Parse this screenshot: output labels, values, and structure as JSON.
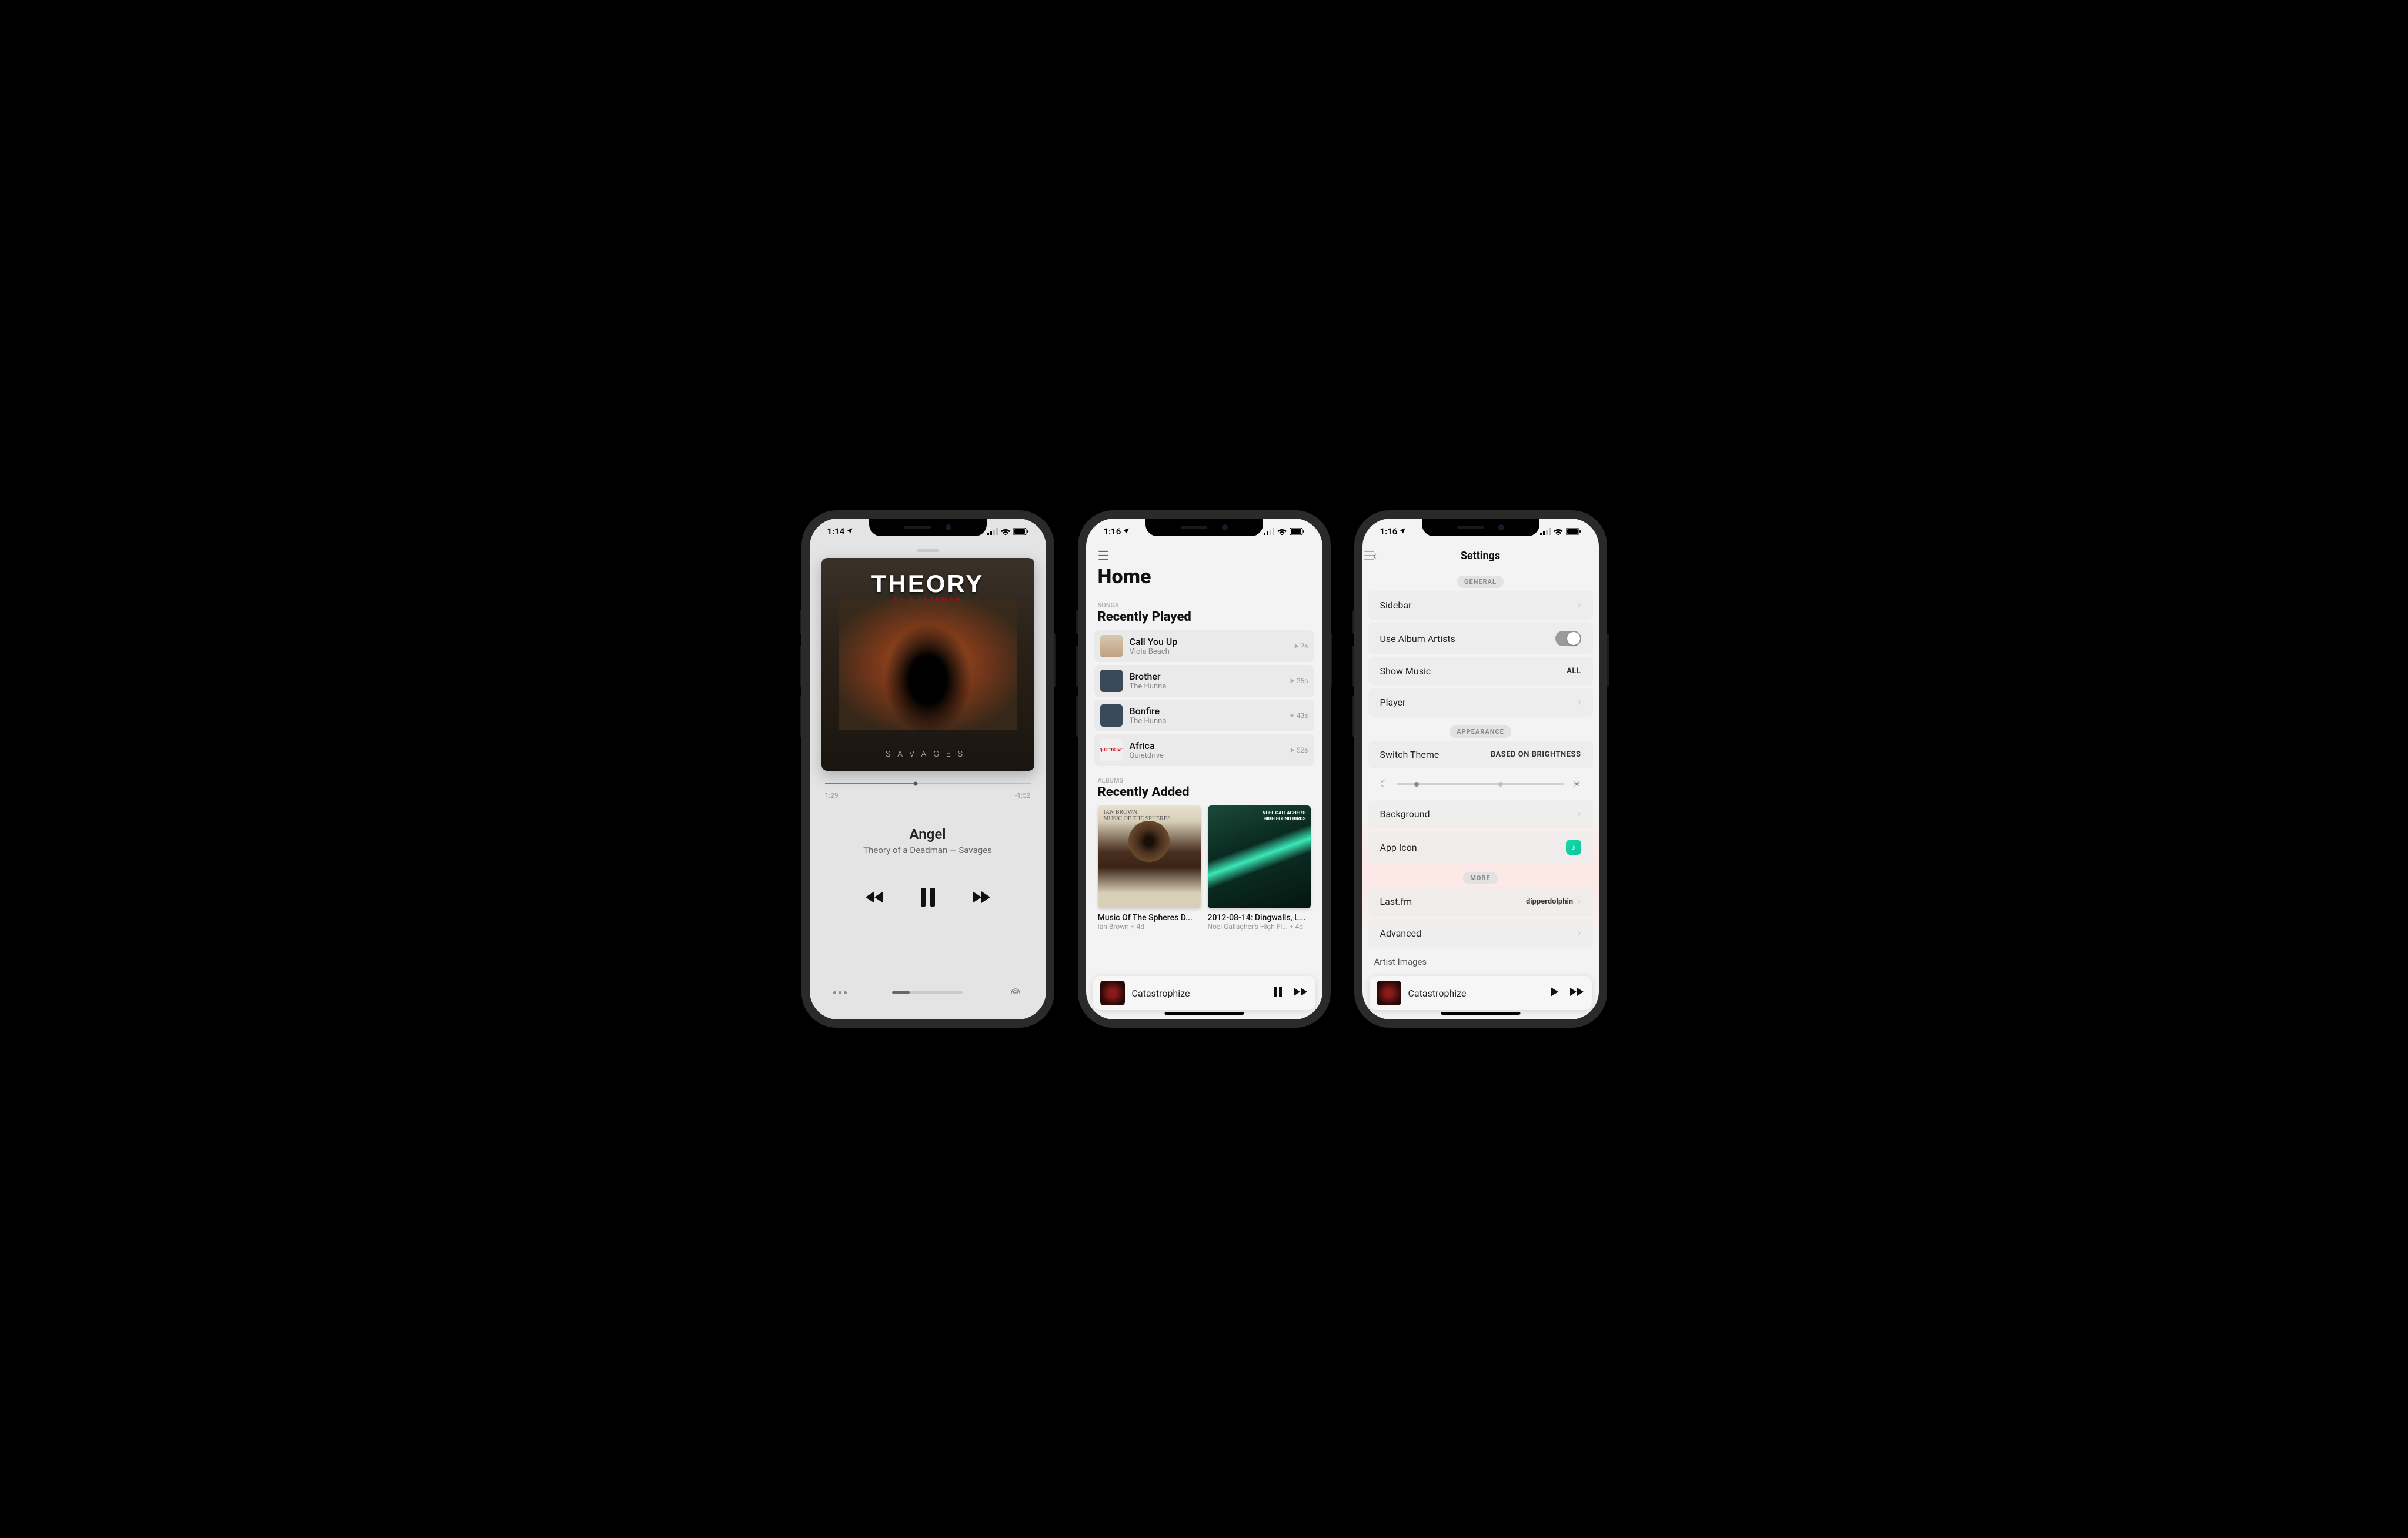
{
  "screen1": {
    "status_time": "1:14",
    "album_art": {
      "band": "THEORY",
      "subline": "OF A DEADMAN",
      "album_word": "SAVAGES"
    },
    "progress": {
      "elapsed": "1:29",
      "remaining": "-1:52",
      "percent": 44
    },
    "track": "Angel",
    "artist": "Theory of a Deadman",
    "album": "Savages",
    "separator": " — "
  },
  "screen2": {
    "status_time": "1:16",
    "title": "Home",
    "songs_label": "SONGS",
    "recently_played": "Recently Played",
    "songs": [
      {
        "title": "Call You Up",
        "artist": "Viola Beach",
        "time": "7s"
      },
      {
        "title": "Brother",
        "artist": "The Hunna",
        "time": "25s"
      },
      {
        "title": "Bonfire",
        "artist": "The Hunna",
        "time": "43s"
      },
      {
        "title": "Africa",
        "artist": "Quietdrive",
        "time": "52s"
      }
    ],
    "albums_label": "ALBUMS",
    "recently_added": "Recently Added",
    "albums": [
      {
        "title": "Music Of The Spheres D...",
        "meta": "Ian Brown + 4d"
      },
      {
        "title": "2012-08-14: Dingwalls, L...",
        "meta": "Noel Gallagher's High Fl... + 4d"
      }
    ],
    "miniplayer": {
      "track": "Catastrophize"
    }
  },
  "screen3": {
    "status_time": "1:16",
    "title": "Settings",
    "groups": {
      "general": "GENERAL",
      "appearance": "APPEARANCE",
      "more": "MORE"
    },
    "rows": {
      "sidebar": "Sidebar",
      "use_album_artists": "Use Album Artists",
      "show_music": "Show Music",
      "show_music_val": "ALL",
      "player": "Player",
      "switch_theme": "Switch Theme",
      "switch_theme_val": "BASED ON BRIGHTNESS",
      "background": "Background",
      "app_icon": "App Icon",
      "lastfm": "Last.fm",
      "lastfm_val": "dipperdolphin",
      "advanced": "Advanced",
      "artist_images": "Artist Images"
    },
    "miniplayer": {
      "track": "Catastrophize"
    }
  }
}
